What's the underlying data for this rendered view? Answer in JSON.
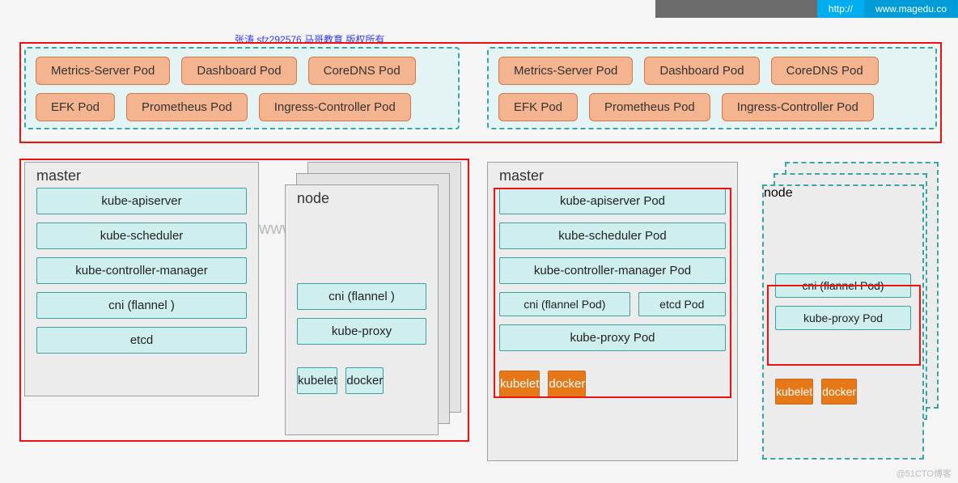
{
  "topbar": {
    "http": "http://",
    "url": "www.magedu.co"
  },
  "copyright": "张涛 sfz292576  马哥教育 版权所有",
  "watermark": "www.magedu.com",
  "footer_mark": "@51CTO博客",
  "addons_left": {
    "row1": [
      "Metrics-Server Pod",
      "Dashboard Pod",
      "CoreDNS Pod"
    ],
    "row2": [
      "EFK Pod",
      "Prometheus Pod",
      "Ingress-Controller Pod"
    ]
  },
  "addons_right": {
    "row1": [
      "Metrics-Server Pod",
      "Dashboard Pod",
      "CoreDNS Pod"
    ],
    "row2": [
      "EFK Pod",
      "Prometheus Pod",
      "Ingress-Controller Pod"
    ]
  },
  "left": {
    "master": {
      "title": "master",
      "items": [
        "kube-apiserver",
        "kube-scheduler",
        "kube-controller-manager",
        "cni (flannel )",
        "etcd"
      ]
    },
    "node": {
      "title": "node",
      "items": [
        "cni (flannel )",
        "kube-proxy"
      ],
      "svc": [
        "kubelet",
        "docker"
      ]
    }
  },
  "right": {
    "master": {
      "title": "master",
      "items": [
        "kube-apiserver Pod",
        "kube-scheduler Pod",
        "kube-controller-manager Pod"
      ],
      "row": [
        "cni (flannel  Pod)",
        "etcd Pod"
      ],
      "last": "kube-proxy Pod",
      "svc": [
        "kubelet",
        "docker"
      ]
    },
    "node": {
      "title": "node",
      "items": [
        "cni (flannel  Pod)",
        "kube-proxy Pod"
      ],
      "svc": [
        "kubelet",
        "docker"
      ]
    }
  }
}
